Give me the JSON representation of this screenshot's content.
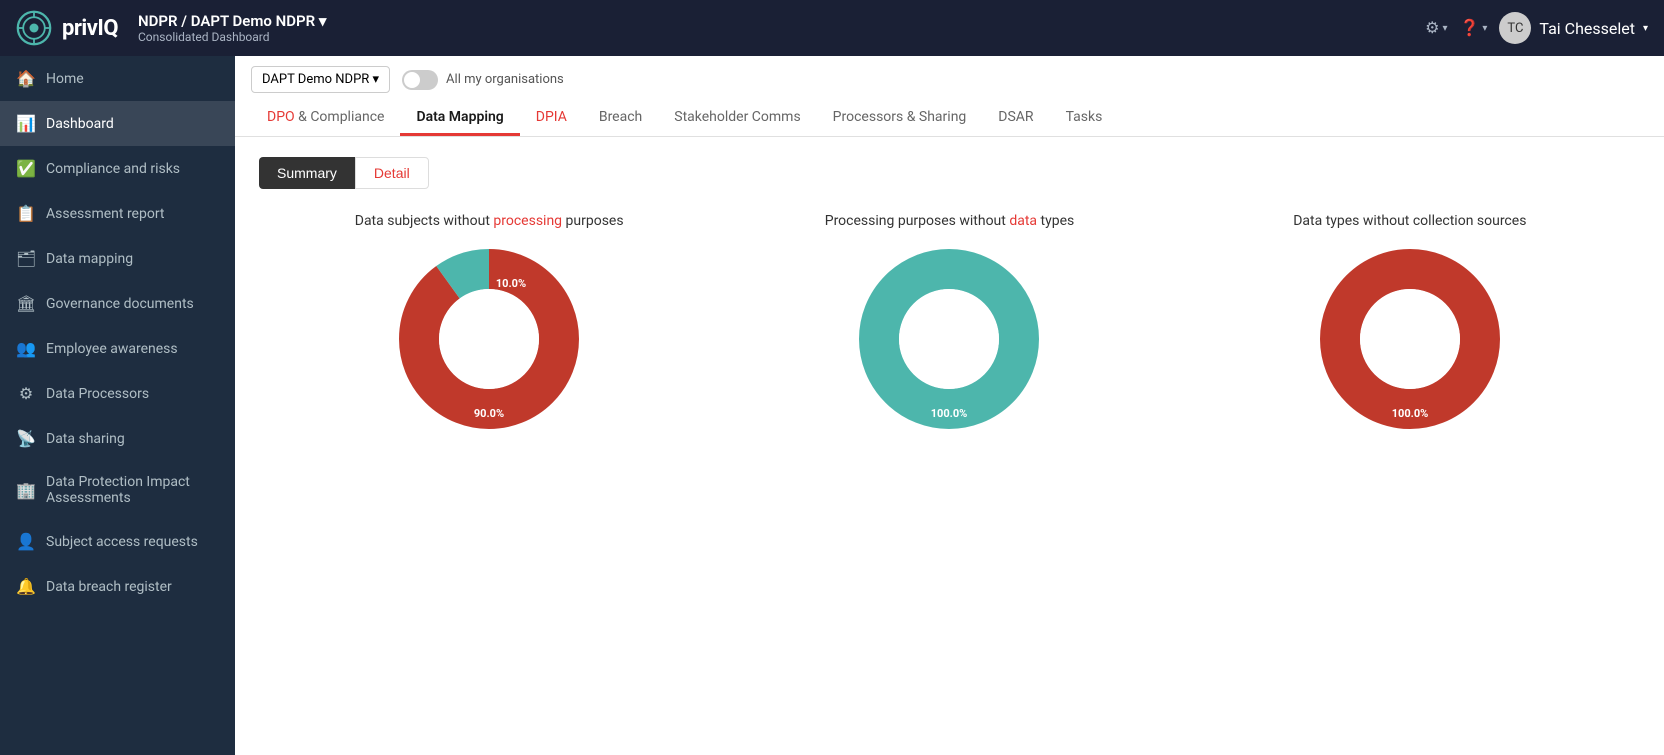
{
  "header": {
    "logo": "privIQ",
    "breadcrumb": "NDPR / DAPT Demo NDPR ▾",
    "subtitle": "Consolidated Dashboard",
    "user": "Tai Chesselet",
    "settings_label": "⚙",
    "help_label": "?"
  },
  "org_selector": {
    "label": "DAPT Demo NDPR ▾"
  },
  "toggle": {
    "label": "All my organisations"
  },
  "tabs": [
    {
      "id": "dpo",
      "label": "DPO & Compliance",
      "class": "dpo"
    },
    {
      "id": "data-mapping",
      "label": "Data Mapping",
      "class": "active"
    },
    {
      "id": "dpia",
      "label": "DPIA",
      "class": "dpia"
    },
    {
      "id": "breach",
      "label": "Breach",
      "class": ""
    },
    {
      "id": "stakeholder",
      "label": "Stakeholder Comms",
      "class": ""
    },
    {
      "id": "processors",
      "label": "Processors & Sharing",
      "class": ""
    },
    {
      "id": "dsar",
      "label": "DSAR",
      "class": ""
    },
    {
      "id": "tasks",
      "label": "Tasks",
      "class": ""
    }
  ],
  "view_toggle": {
    "summary_label": "Summary",
    "detail_label": "Detail"
  },
  "charts": [
    {
      "id": "chart1",
      "title_parts": [
        "Data subjects without ",
        "processing",
        " purposes"
      ],
      "highlight_class": "red",
      "segments": [
        {
          "value": 90.0,
          "color": "#c0392b",
          "label": "90.0%"
        },
        {
          "value": 10.0,
          "color": "#4db6ac",
          "label": "10.0%"
        }
      ]
    },
    {
      "id": "chart2",
      "title_parts": [
        "Processing purposes without ",
        "data",
        " types"
      ],
      "highlight_class": "teal",
      "segments": [
        {
          "value": 100.0,
          "color": "#4db6ac",
          "label": "100.0%"
        }
      ]
    },
    {
      "id": "chart3",
      "title_parts": [
        "Data types without collection sources"
      ],
      "highlight_class": "none",
      "segments": [
        {
          "value": 100.0,
          "color": "#c0392b",
          "label": "100.0%"
        }
      ]
    }
  ],
  "sidebar": {
    "items": [
      {
        "id": "home",
        "label": "Home",
        "icon": "🏠"
      },
      {
        "id": "dashboard",
        "label": "Dashboard",
        "icon": "📊",
        "active": true
      },
      {
        "id": "compliance",
        "label": "Compliance and risks",
        "icon": "✅"
      },
      {
        "id": "assessment",
        "label": "Assessment report",
        "icon": "📋"
      },
      {
        "id": "data-mapping",
        "label": "Data mapping",
        "icon": "🗂"
      },
      {
        "id": "governance",
        "label": "Governance documents",
        "icon": "🏛"
      },
      {
        "id": "employee",
        "label": "Employee awareness",
        "icon": "👥"
      },
      {
        "id": "processors",
        "label": "Data Processors",
        "icon": "⚙"
      },
      {
        "id": "sharing",
        "label": "Data sharing",
        "icon": "📡"
      },
      {
        "id": "dpia",
        "label": "Data Protection Impact Assessments",
        "icon": "🏢"
      },
      {
        "id": "subject-access",
        "label": "Subject access requests",
        "icon": "👤"
      },
      {
        "id": "breach-register",
        "label": "Data breach register",
        "icon": "🔔"
      }
    ]
  }
}
